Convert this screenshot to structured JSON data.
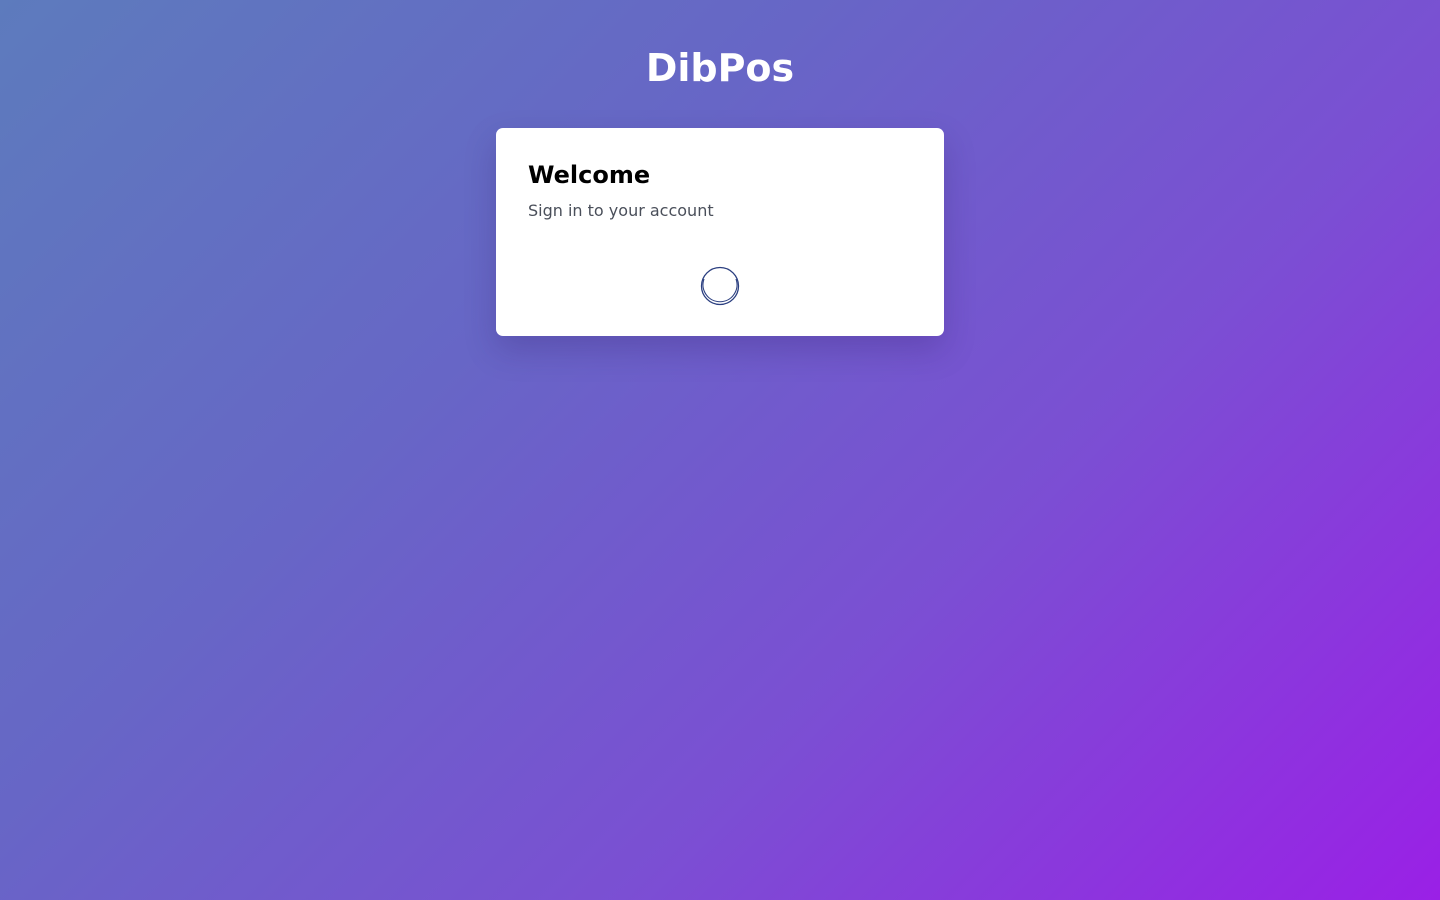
{
  "app": {
    "title": "DibPos"
  },
  "login_card": {
    "title": "Welcome",
    "subtitle": "Sign in to your account",
    "status_icon": "loading-spinner-icon"
  },
  "colors": {
    "background_gradient_start": "#5d7bbd",
    "background_gradient_end": "#9a20e6",
    "card_background": "#ffffff",
    "spinner": "#2b3f80"
  }
}
